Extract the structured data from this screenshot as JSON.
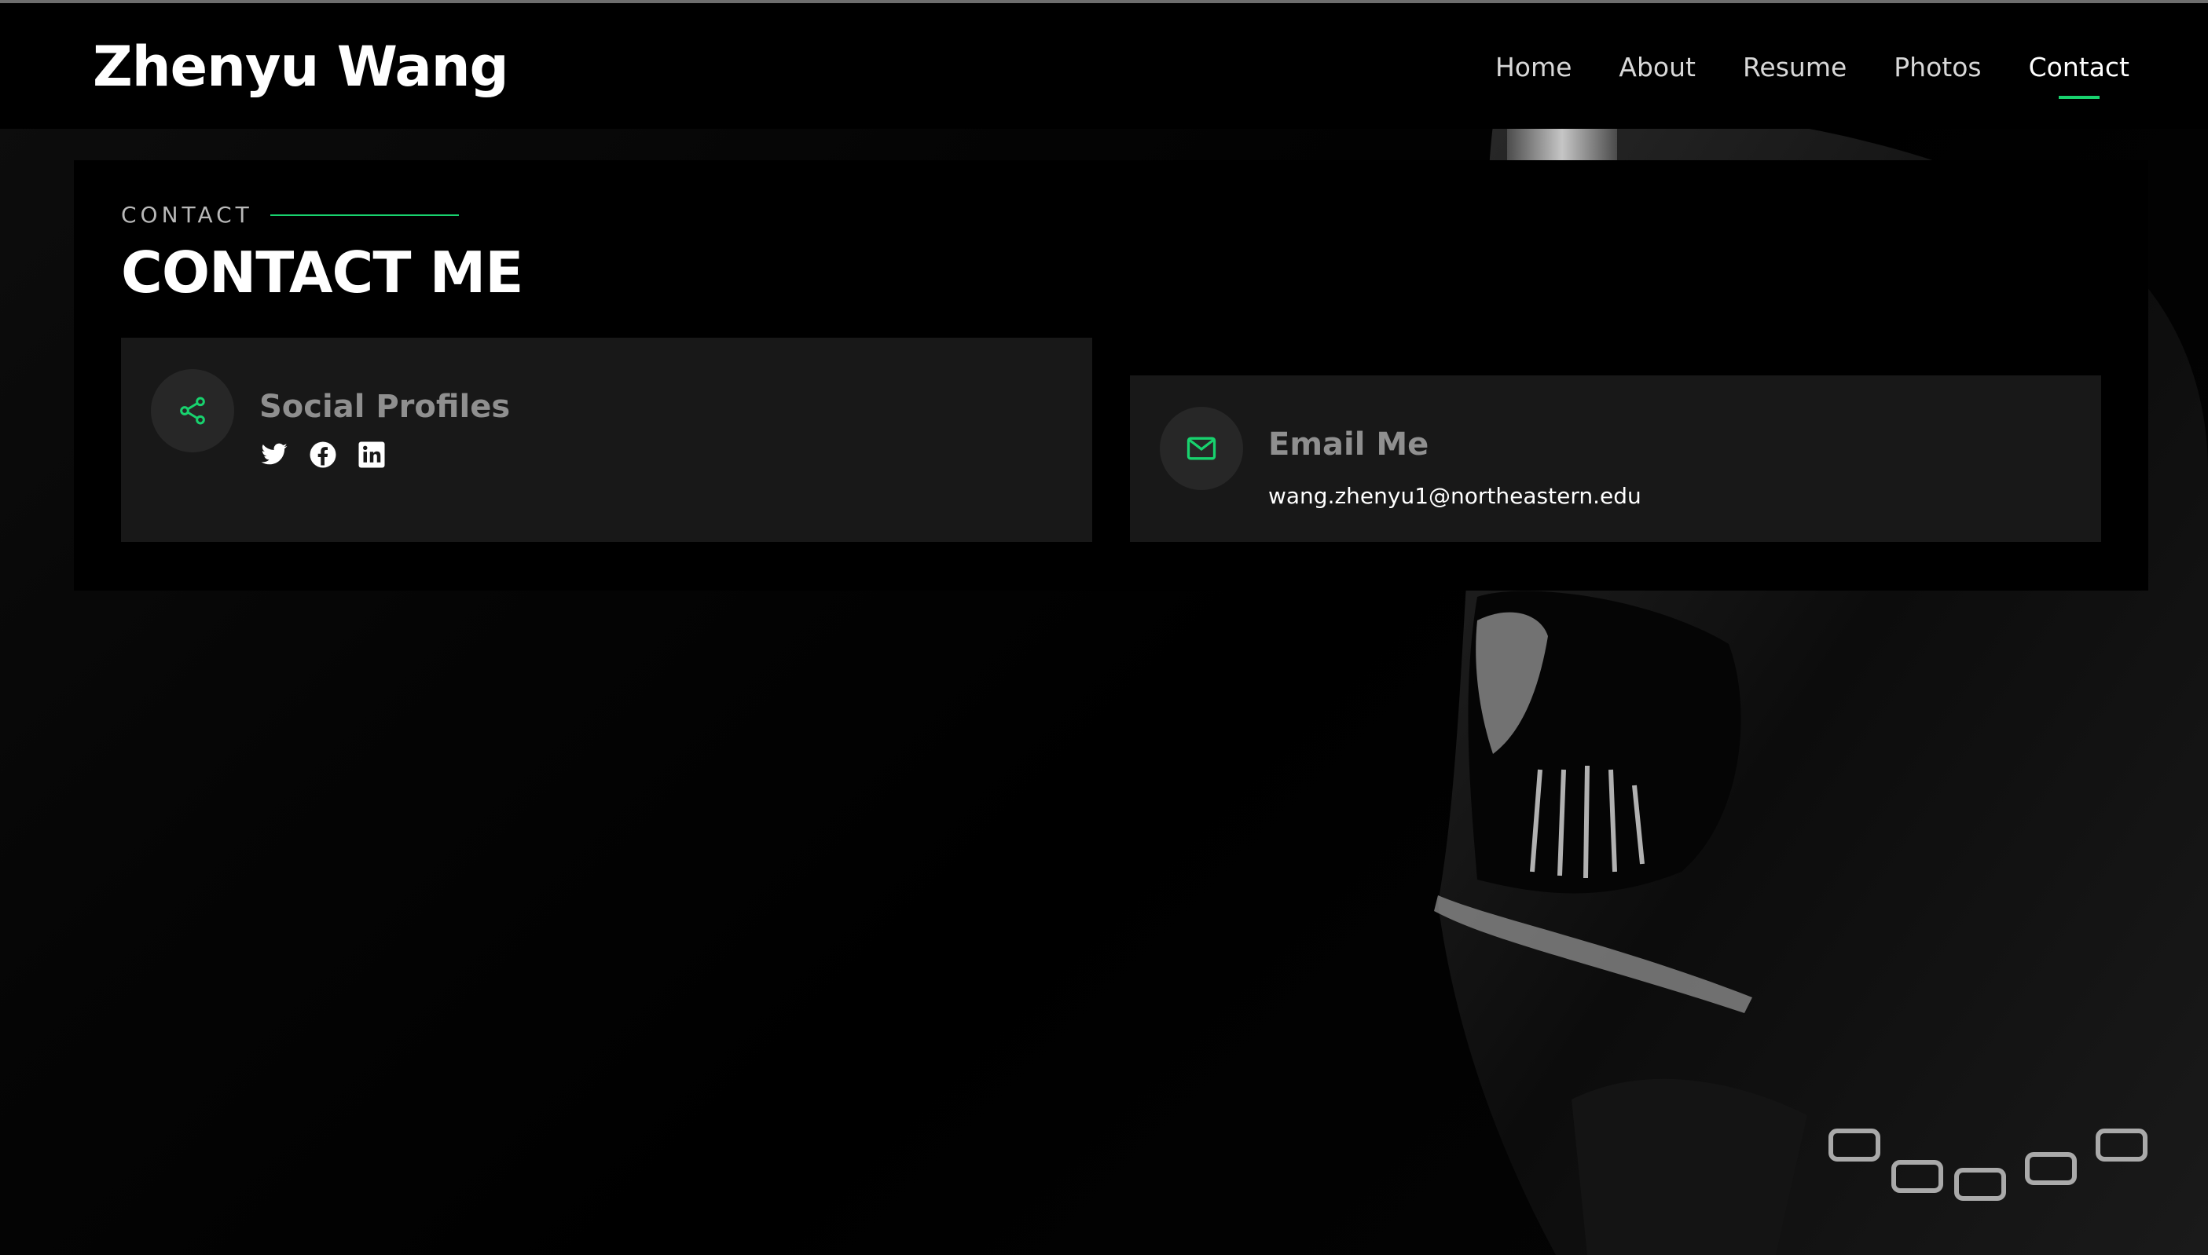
{
  "header": {
    "logo": "Zhenyu Wang",
    "nav": [
      {
        "label": "Home",
        "active": false
      },
      {
        "label": "About",
        "active": false
      },
      {
        "label": "Resume",
        "active": false
      },
      {
        "label": "Photos",
        "active": false
      },
      {
        "label": "Contact",
        "active": true
      }
    ]
  },
  "contact": {
    "eyebrow": "CONTACT",
    "title": "CONTACT ME",
    "social": {
      "title": "Social Profiles",
      "icon": "share-icon",
      "links": [
        {
          "name": "twitter-icon"
        },
        {
          "name": "facebook-icon"
        },
        {
          "name": "linkedin-icon"
        }
      ]
    },
    "email": {
      "title": "Email Me",
      "icon": "envelope-icon",
      "address": "wang.zhenyu1@northeastern.edu"
    }
  },
  "colors": {
    "accent": "#18d26e",
    "card_bg": "#181818",
    "page_bg": "#000000"
  }
}
